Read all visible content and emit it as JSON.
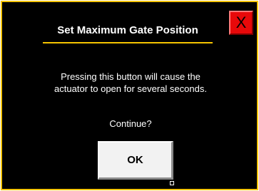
{
  "dialog": {
    "title": "Set Maximum Gate Position",
    "close_label": "X",
    "message_line1": "Pressing this button will cause the",
    "message_line2": "actuator to open for several seconds.",
    "prompt": "Continue?",
    "ok_label": "OK"
  },
  "colors": {
    "background": "#000000",
    "border": "#f5c400",
    "close_button": "#e8090a",
    "text": "#ffffff",
    "ok_button": "#f2f2f2"
  },
  "icons": {
    "close": "close-icon"
  }
}
